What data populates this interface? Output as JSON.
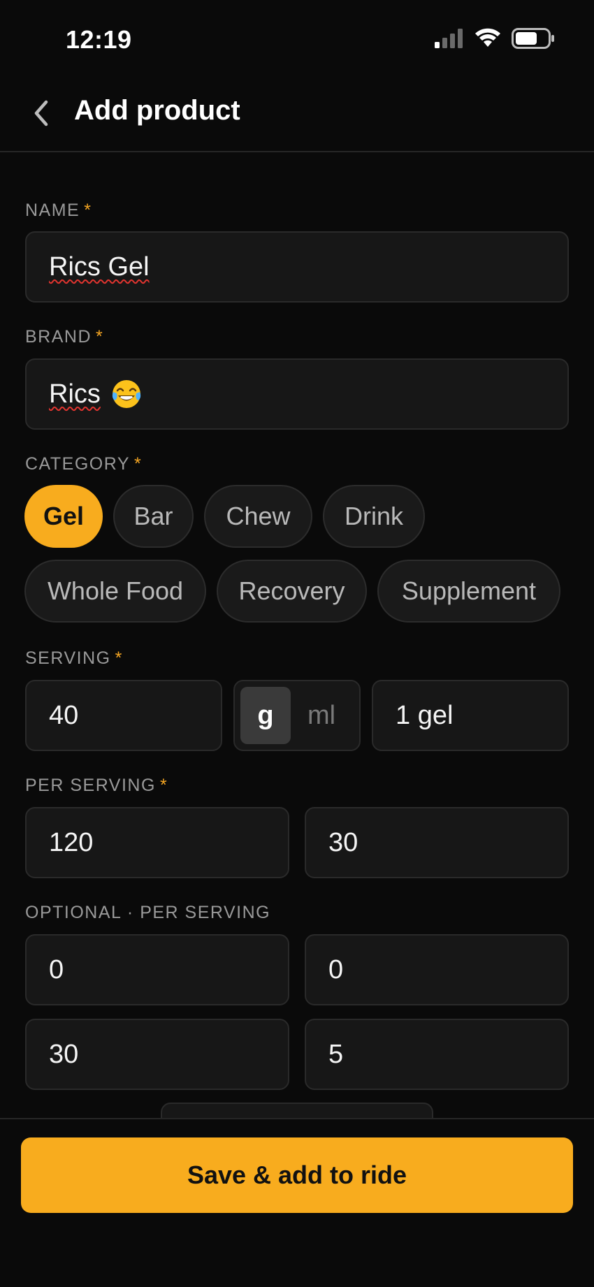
{
  "status_bar": {
    "time": "12:19",
    "icons": [
      "signal-icon",
      "wifi-icon",
      "battery-icon"
    ]
  },
  "header": {
    "title": "Add product",
    "back_icon": "chevron-left-icon"
  },
  "form": {
    "required_marker": "*",
    "name": {
      "label": "NAME",
      "value": "Rics Gel"
    },
    "brand": {
      "label": "BRAND",
      "value": "Rics",
      "emoji": "😂"
    },
    "category": {
      "label": "CATEGORY",
      "options": [
        "Gel",
        "Bar",
        "Chew",
        "Drink",
        "Whole Food",
        "Recovery",
        "Supplement"
      ],
      "selected": "Gel"
    },
    "serving": {
      "label": "SERVING",
      "amount": "40",
      "units": [
        "g",
        "ml"
      ],
      "selected_unit": "g",
      "description": "1 gel"
    },
    "per_serving": {
      "label": "PER SERVING",
      "values": [
        "120",
        "30"
      ]
    },
    "optional": {
      "label": "OPTIONAL · PER SERVING",
      "values": [
        "0",
        "0",
        "30",
        "5"
      ]
    }
  },
  "footer": {
    "save_label": "Save & add to ride"
  },
  "colors": {
    "accent": "#f8ac1e",
    "background": "#0a0a0a",
    "input_bg": "#171717",
    "error_underline": "#e0342f"
  }
}
